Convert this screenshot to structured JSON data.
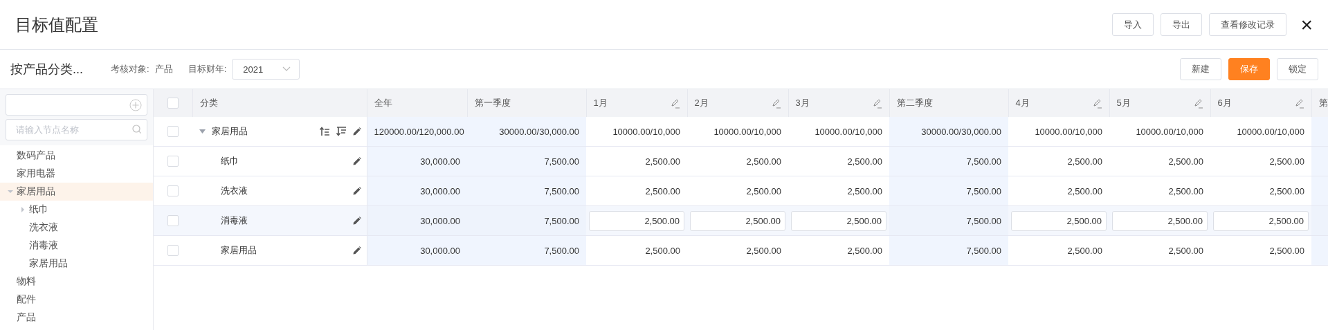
{
  "dialog": {
    "title": "目标值配置",
    "close_icon": "×",
    "actions": [
      "导入",
      "导出",
      "查看修改记录"
    ]
  },
  "toolbar": {
    "heading": "按产品分类...",
    "fields": [
      {
        "label": "考核对象:",
        "value": "产品",
        "kind": "text"
      },
      {
        "label": "目标财年:",
        "value": "2021",
        "kind": "select"
      }
    ],
    "buttons": [
      {
        "label": "新建",
        "primary": false
      },
      {
        "label": "保存",
        "primary": true
      },
      {
        "label": "锁定",
        "primary": false
      }
    ]
  },
  "sidebar": {
    "search": {
      "placeholder": "请输入节点名称"
    },
    "tree": [
      {
        "label": "数码产品",
        "selected": false
      },
      {
        "label": "家用电器",
        "selected": false
      },
      {
        "label": "家居用品",
        "selected": true,
        "expanded": true,
        "children": [
          {
            "label": "纸巾",
            "selected": false,
            "expanded": false
          },
          {
            "label": "洗衣液",
            "selected": false
          },
          {
            "label": "消毒液",
            "selected": false
          },
          {
            "label": "家居用品",
            "selected": false
          }
        ]
      },
      {
        "label": "物料",
        "selected": false
      },
      {
        "label": "配件",
        "selected": false
      },
      {
        "label": "产品",
        "selected": false
      }
    ]
  },
  "table": {
    "select_all": {
      "checked": false
    },
    "columns": [
      {
        "label": "分类",
        "kind": "name"
      },
      {
        "label": "全年",
        "kind": "total"
      },
      {
        "label": "第一季度",
        "kind": "quarter"
      },
      {
        "label": "1月",
        "kind": "month"
      },
      {
        "label": "2月",
        "kind": "month"
      },
      {
        "label": "3月",
        "kind": "month"
      },
      {
        "label": "第二季度",
        "kind": "quarter"
      },
      {
        "label": "4月",
        "kind": "month"
      },
      {
        "label": "5月",
        "kind": "month"
      },
      {
        "label": "6月",
        "kind": "month"
      },
      {
        "label": "第",
        "kind": "quarter"
      }
    ],
    "rows": [
      {
        "name": "家居用品",
        "kind": "group",
        "expanded": true,
        "checked": false,
        "selected": false,
        "values": [
          "120000.00/120,000.00",
          "30000.00/30,000.00",
          "10000.00/10,000",
          "10000.00/10,000",
          "10000.00/10,000",
          "30000.00/30,000.00",
          "10000.00/10,000",
          "10000.00/10,000",
          "10000.00/10,000"
        ]
      },
      {
        "name": "纸巾",
        "kind": "item",
        "checked": false,
        "selected": false,
        "values": [
          "30,000.00",
          "7,500.00",
          "2,500.00",
          "2,500.00",
          "2,500.00",
          "7,500.00",
          "2,500.00",
          "2,500.00",
          "2,500.00"
        ]
      },
      {
        "name": "洗衣液",
        "kind": "item",
        "checked": false,
        "selected": false,
        "values": [
          "30,000.00",
          "7,500.00",
          "2,500.00",
          "2,500.00",
          "2,500.00",
          "7,500.00",
          "2,500.00",
          "2,500.00",
          "2,500.00"
        ]
      },
      {
        "name": "消毒液",
        "kind": "item",
        "checked": false,
        "selected": true,
        "values": [
          "30,000.00",
          "7,500.00",
          "2,500.00",
          "2,500.00",
          "2,500.00",
          "7,500.00",
          "2,500.00",
          "2,500.00",
          "2,500.00"
        ]
      },
      {
        "name": "家居用品",
        "kind": "item",
        "checked": false,
        "selected": false,
        "values": [
          "30,000.00",
          "7,500.00",
          "2,500.00",
          "2,500.00",
          "2,500.00",
          "7,500.00",
          "2,500.00",
          "2,500.00",
          "2,500.00"
        ]
      }
    ]
  }
}
